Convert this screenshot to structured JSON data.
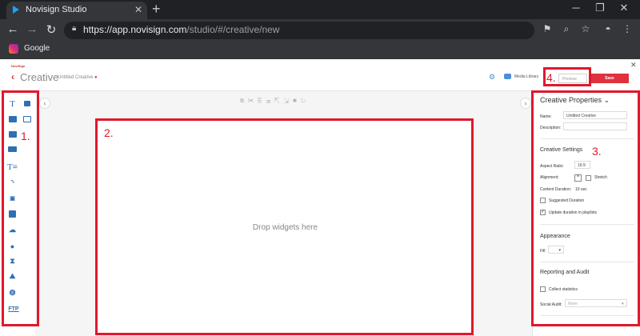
{
  "browser": {
    "tab_title": "Novisign Studio",
    "url_host": "https://app.novisign.com",
    "url_path": "/studio/#/creative/new",
    "bookmark": "Google"
  },
  "app": {
    "logo_text": "NoviSign",
    "title": "Creative",
    "doc_name": "Untitled Creative",
    "media_library": "Media Library",
    "preview_placeholder": "Preview",
    "save_label": "Save",
    "canvas_hint": "Drop widgets here"
  },
  "widgets": [
    "text-widget-icon",
    "ticker-widget-icon",
    "image-widget-icon",
    "slideshow-widget-icon",
    "video-widget-icon",
    "social-widget-icon",
    "list-widget-icon",
    "rss-widget-icon",
    "youtube-widget-icon",
    "app-widget-icon",
    "weather-widget-icon",
    "clock-widget-icon",
    "countdown-widget-icon",
    "maps-widget-icon",
    "web-widget-icon",
    "ftp-widget-icon"
  ],
  "widget_ftp_text": "FTP",
  "properties": {
    "title": "Creative Properties",
    "name_label": "Name:",
    "name_value": "Untitled Creative",
    "description_label": "Description:",
    "settings_title": "Creative Settings",
    "aspect_label": "Aspect Ratio:",
    "aspect_value": "16:9",
    "alignment_label": "Alignment:",
    "stretch_label": "Stretch",
    "duration_label": "Content Duration:",
    "duration_value": "10 sec",
    "suggested_label": "Suggested Duration",
    "update_label": "Update duration in playlists",
    "appearance_title": "Appearance",
    "fill_label": "Fill:",
    "reporting_title": "Reporting and Audit",
    "collect_label": "Collect statistics",
    "audit_label": "Social Audit:",
    "audit_value": "None"
  },
  "annotations": {
    "one": "1.",
    "two": "2.",
    "three": "3.",
    "four": "4."
  },
  "colors": {
    "accent": "#e0313f",
    "annotation": "#e0182d",
    "widget_blue": "#2f6fb3"
  }
}
